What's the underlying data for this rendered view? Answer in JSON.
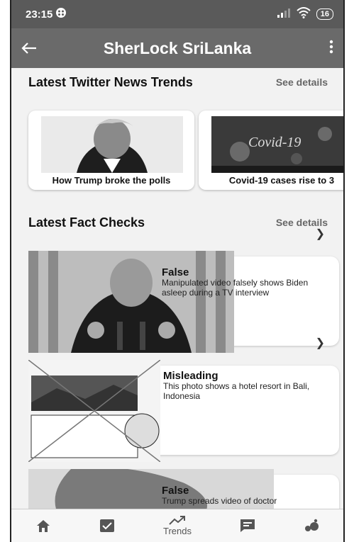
{
  "status": {
    "time": "23:15",
    "battery": "16"
  },
  "appbar": {
    "title": "SherLock SriLanka"
  },
  "twitter_section": {
    "title": "Latest Twitter News Trends",
    "see_details": "See details",
    "cards": [
      {
        "caption": "How Trump broke the polls"
      },
      {
        "caption": "Covid-19 cases rise to 3",
        "image_text": "Covid-19"
      }
    ]
  },
  "fact_section": {
    "title": "Latest Fact Checks",
    "see_details": "See details",
    "items": [
      {
        "verdict": "False",
        "text": "Manipulated video falsely shows Biden asleep during a TV interview"
      },
      {
        "verdict": "Misleading",
        "text": "This photo shows a hotel resort in Bali, Indonesia"
      },
      {
        "verdict": "False",
        "text": "Trump spreads video of doctor"
      }
    ]
  },
  "bottom_nav": {
    "trends_label": "Trends"
  }
}
